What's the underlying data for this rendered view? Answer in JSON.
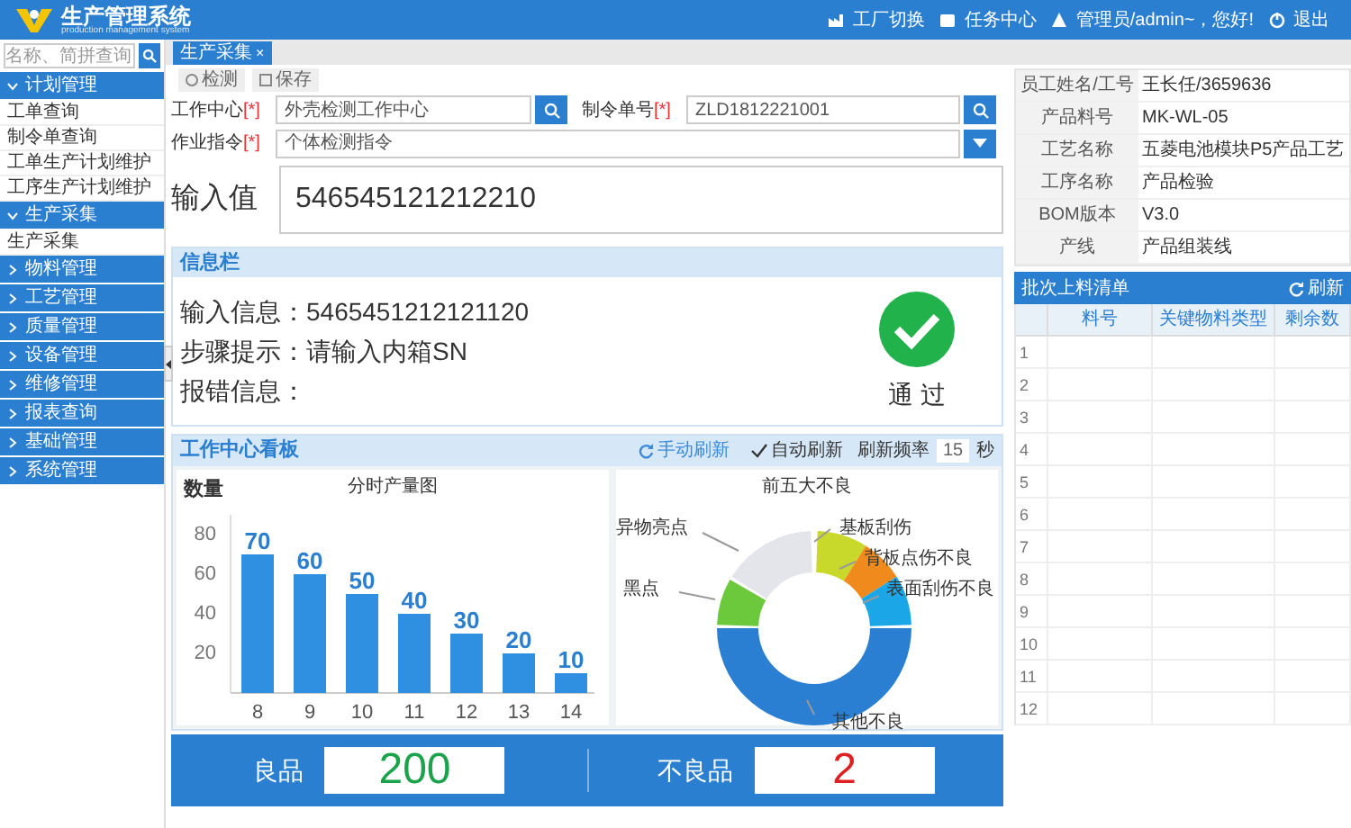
{
  "header": {
    "title": "生产管理系统",
    "subtitle": "production management system",
    "links": [
      {
        "kind": "factory",
        "label": "工厂切换"
      },
      {
        "kind": "task",
        "label": "任务中心"
      },
      {
        "kind": "user",
        "label": "管理员/admin~，您好!"
      },
      {
        "kind": "logout",
        "label": "退出"
      }
    ]
  },
  "sidebar": {
    "search": {
      "placeholder": "名称、简拼查询"
    },
    "groups": [
      {
        "label": "计划管理",
        "expanded": true,
        "children": [
          {
            "label": "工单查询"
          },
          {
            "label": "制令单查询"
          },
          {
            "label": "工单生产计划维护"
          },
          {
            "label": "工序生产计划维护"
          }
        ]
      },
      {
        "label": "生产采集",
        "expanded": true,
        "children": [
          {
            "label": "生产采集"
          }
        ]
      },
      {
        "label": "物料管理",
        "expanded": false
      },
      {
        "label": "工艺管理",
        "expanded": false
      },
      {
        "label": "质量管理",
        "expanded": false
      },
      {
        "label": "设备管理",
        "expanded": false
      },
      {
        "label": "维修管理",
        "expanded": false
      },
      {
        "label": "报表查询",
        "expanded": false
      },
      {
        "label": "基础管理",
        "expanded": false
      },
      {
        "label": "系统管理",
        "expanded": false
      }
    ]
  },
  "tabs": [
    {
      "label": "生产采集",
      "close": "×",
      "selected": true
    }
  ],
  "toolbar": [
    {
      "kind": "detect",
      "label": "检测"
    },
    {
      "kind": "save",
      "label": "保存"
    }
  ],
  "form": {
    "work_center": {
      "label": "工作中心",
      "required": "[*]",
      "value": "外壳检测工作中心"
    },
    "order_no": {
      "label": "制令单号",
      "required": "[*]",
      "value": "ZLD1812221001"
    },
    "instruction": {
      "label": "作业指令",
      "required": "[*]",
      "value": "个体检测指令"
    },
    "input_value": {
      "label": "输入值",
      "value": "546545121212210"
    }
  },
  "info_panel": {
    "title": "信息栏",
    "lines": [
      {
        "label": "输入信息：",
        "value": "5465451212121120"
      },
      {
        "label": "步骤提示：",
        "value": "请输入内箱SN"
      },
      {
        "label": "报错信息："
      }
    ],
    "result": "通 过"
  },
  "dashboard": {
    "title": "工作中心看板",
    "refresh": "手动刷新",
    "auto_refresh": {
      "label": "自动刷新",
      "checked": true
    },
    "rate_label": "刷新频率",
    "rate": "15",
    "rate_unit": "秒",
    "bar_chart": {
      "chart_data": {
        "type": "bar",
        "title": "分时产量图",
        "ylabel": "数量",
        "categories": [
          "8",
          "9",
          "10",
          "11",
          "12",
          "13",
          "14"
        ],
        "series": [
          {
            "color": "#2f8fe0",
            "values": [
              70,
              60,
              50,
              40,
              30,
              20,
              10
            ]
          }
        ],
        "ylim": [
          0,
          90
        ],
        "yticks": [
          20,
          40,
          60,
          80
        ],
        "data_labels": true
      }
    },
    "defects": {
      "title": "前五大不良",
      "slices": [
        {
          "label": "基板刮伤",
          "color": "#c9d92c"
        },
        {
          "label": "背板点伤不良",
          "color": "#f08a1c"
        },
        {
          "label": "表面刮伤不良",
          "color": "#1ba6e8"
        },
        {
          "label": "其他不良",
          "color": "#2b7fd2"
        },
        {
          "label": "黑点",
          "color": "#6cc93c"
        },
        {
          "label": "异物亮点",
          "color": "#e4e5ea"
        }
      ]
    }
  },
  "totals": [
    {
      "label": "良品",
      "value": "200",
      "kind": "good"
    },
    {
      "label": "不良品",
      "value": "2",
      "kind": "bad"
    }
  ],
  "details": [
    {
      "label": "员工姓名/工号",
      "value": "王长任/3659636"
    },
    {
      "label": "产品料号",
      "value": "MK-WL-05"
    },
    {
      "label": "工艺名称",
      "value": "五菱电池模块P5产品工艺"
    },
    {
      "label": "工序名称",
      "value": "产品检验"
    },
    {
      "label": "BOM版本",
      "value": "V3.0"
    },
    {
      "label": "产线",
      "value": "产品组装线"
    }
  ],
  "batch_list": {
    "title": "批次上料清单",
    "refresh": "刷新",
    "columns": [
      "料号",
      "关键物料类型",
      "剩余数"
    ],
    "row_numbers": [
      "1",
      "2",
      "3",
      "4",
      "5",
      "6",
      "7",
      "8",
      "9",
      "10",
      "11",
      "12"
    ]
  }
}
